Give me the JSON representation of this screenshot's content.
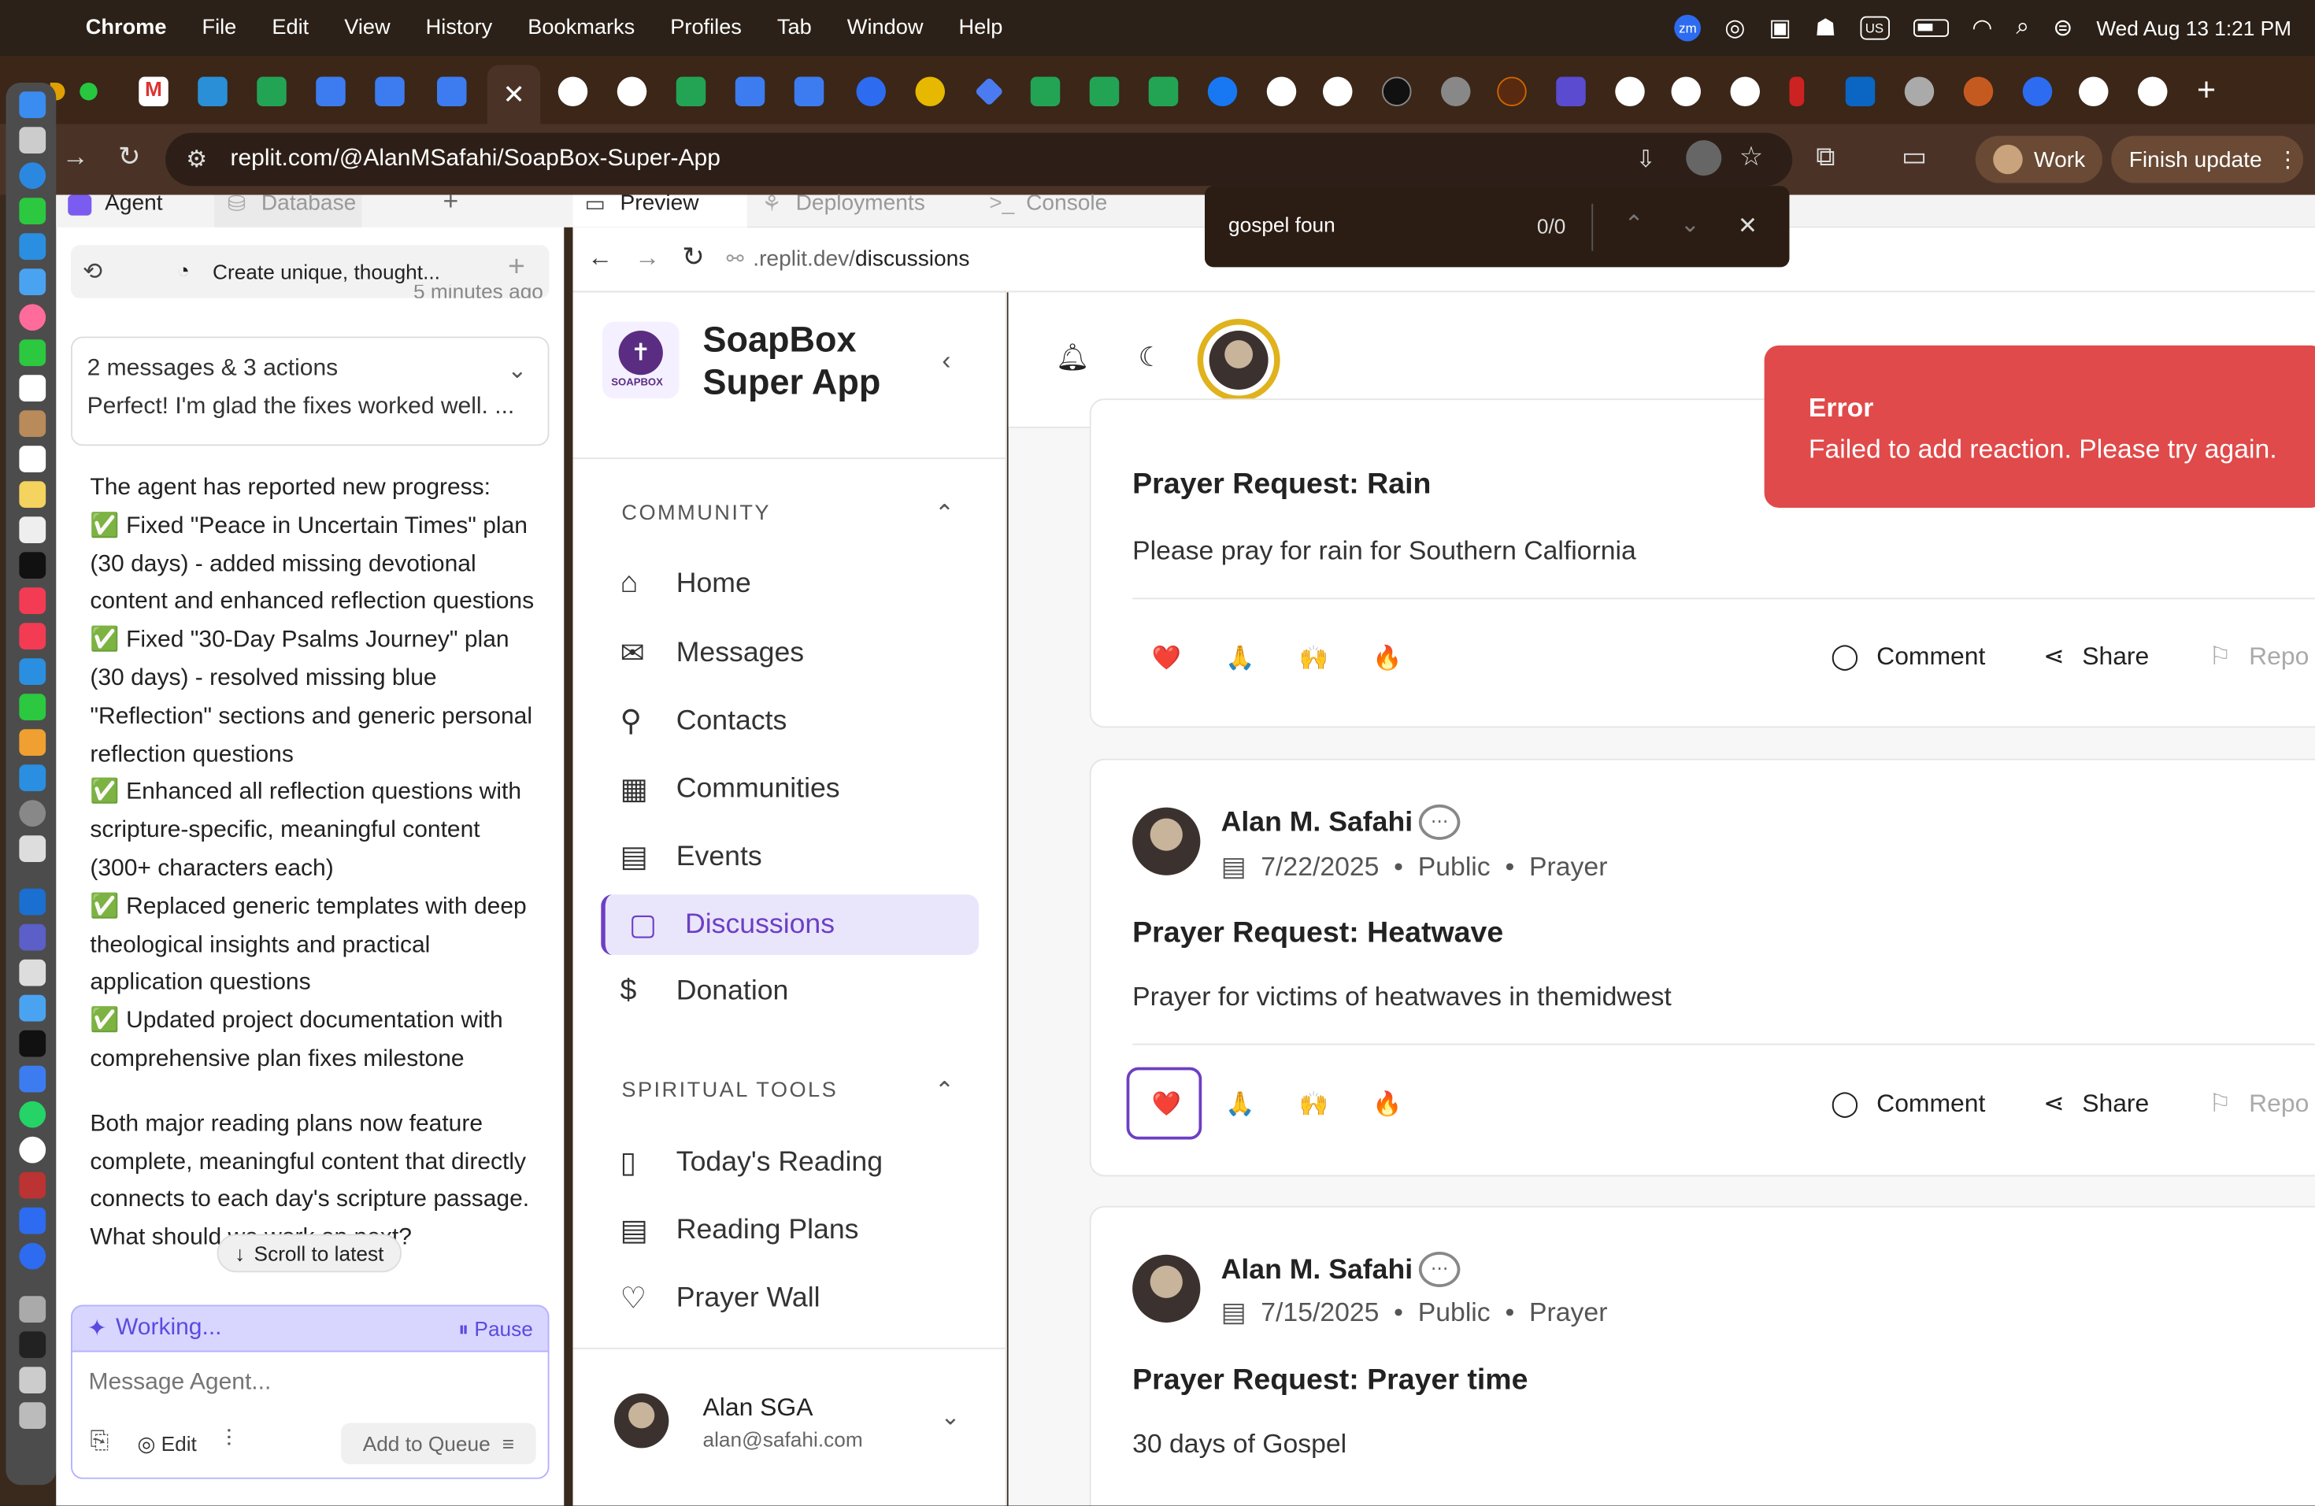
{
  "menubar": {
    "app": "Chrome",
    "items": [
      "File",
      "Edit",
      "View",
      "History",
      "Bookmarks",
      "Profiles",
      "Tab",
      "Window",
      "Help"
    ],
    "keyboard": "US",
    "datetime": "Wed Aug 13  1:21 PM"
  },
  "browser": {
    "url": "replit.com/@AlanMSafahi/SoapBox-Super-App",
    "profile": "Work",
    "finish_update": "Finish update"
  },
  "find": {
    "query": "gospel foun",
    "count": "0/0"
  },
  "replit": {
    "tabs": [
      "Agent",
      "Database"
    ],
    "preview_tabs": [
      "Preview",
      "Deployments",
      "Console"
    ],
    "agent_title": "Create unique, thought...",
    "timestamp": "5 minutes ago",
    "summary_title": "2 messages & 3 actions",
    "summary_text": "Perfect! I'm glad the fixes worked well. ...",
    "progress_intro": "The agent has reported new progress:",
    "progress_items": [
      "✅ Fixed \"Peace in Uncertain Times\" plan (30 days) - added missing devotional content and enhanced reflection questions",
      "✅ Fixed \"30-Day Psalms Journey\" plan (30 days) - resolved missing blue \"Reflection\" sections and generic personal reflection questions",
      "✅ Enhanced all reflection questions with scripture-specific, meaningful content (300+ characters each)",
      "✅ Replaced generic templates with deep theological insights and practical application questions",
      "✅ Updated project documentation with comprehensive plan fixes milestone"
    ],
    "closing": "Both major reading plans now feature complete, meaningful content that directly connects to each day's scripture passage. What should we work on next?",
    "scroll_latest": "Scroll to latest",
    "working": "Working...",
    "pause": "Pause",
    "message_placeholder": "Message Agent...",
    "edit": "Edit",
    "add_to_queue": "Add to Queue",
    "preview_url_prefix": ".replit.dev/",
    "preview_url_path": "discussions"
  },
  "app": {
    "title_line1": "SoapBox",
    "title_line2": "Super App",
    "logo_text": "SOAPBOX",
    "community_header": "COMMUNITY",
    "nav": [
      "Home",
      "Messages",
      "Contacts",
      "Communities",
      "Events",
      "Discussions",
      "Donation"
    ],
    "tools_header": "SPIRITUAL TOOLS",
    "tools": [
      "Today's Reading",
      "Reading Plans",
      "Prayer Wall"
    ],
    "user_name": "Alan SGA",
    "user_email": "alan@safahi.com"
  },
  "posts": [
    {
      "title": "Prayer Request: Rain",
      "body": "Please pray for rain for Southern Calfiornia"
    },
    {
      "author": "Alan M. Safahi",
      "date": "7/22/2025",
      "visibility": "Public",
      "category": "Prayer",
      "title": "Prayer Request: Heatwave",
      "body": "Prayer for victims of heatwaves in themidwest"
    },
    {
      "author": "Alan M. Safahi",
      "date": "7/15/2025",
      "visibility": "Public",
      "category": "Prayer",
      "title": "Prayer Request: Prayer time",
      "body": "30 days of Gospel"
    }
  ],
  "actions": {
    "comment": "Comment",
    "share": "Share",
    "report": "Repo"
  },
  "reactions": [
    "❤️",
    "🙏",
    "🙌",
    "🔥"
  ],
  "toast": {
    "title": "Error",
    "message": "Failed to add reaction. Please try again."
  },
  "colors": {
    "accent": "#6d3fc4",
    "error": "#e04a4a",
    "active_bg": "#e9e6fc"
  }
}
